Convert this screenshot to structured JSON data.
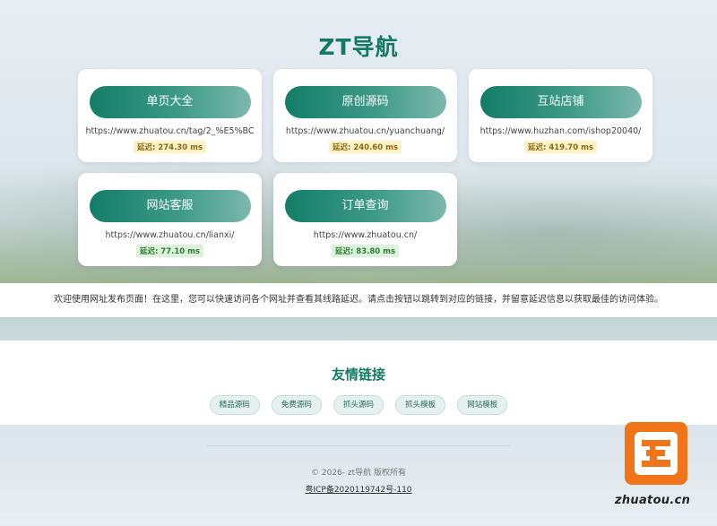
{
  "header": {
    "title": "ZT导航"
  },
  "cards": [
    {
      "label": "单页大全",
      "url": "https://www.zhuatou.cn/tag/2_%E5%BC",
      "latency": "延迟: 274.30 ms",
      "status": "warn"
    },
    {
      "label": "原创源码",
      "url": "https://www.zhuatou.cn/yuanchuang/",
      "latency": "延迟: 240.60 ms",
      "status": "warn"
    },
    {
      "label": "互站店铺",
      "url": "https://www.huzhan.com/ishop20040/",
      "latency": "延迟: 419.70 ms",
      "status": "warn"
    },
    {
      "label": "网站客服",
      "url": "https://www.zhuatou.cn/lianxi/",
      "latency": "延迟: 77.10 ms",
      "status": "good"
    },
    {
      "label": "订单查询",
      "url": "https://www.zhuatou.cn/",
      "latency": "延迟: 83.80 ms",
      "status": "good"
    }
  ],
  "notice": "欢迎使用网址发布页面！在这里，您可以快速访问各个网址并查看其线路延迟。请点击按钮以跳转到对应的链接，并留意延迟信息以获取最佳的访问体验。",
  "friend_links": {
    "title": "友情链接",
    "items": [
      "精品源码",
      "免费源码",
      "抓头源码",
      "抓头模板",
      "网站模板"
    ]
  },
  "footer": {
    "copyright": "© 2026- zt导航 版权所有",
    "icp": "粤ICP备2020119742号-110"
  },
  "watermark": {
    "text": "zhuatou.cn"
  },
  "colors": {
    "brand": "#137a64",
    "accent_orange": "#f27419"
  }
}
